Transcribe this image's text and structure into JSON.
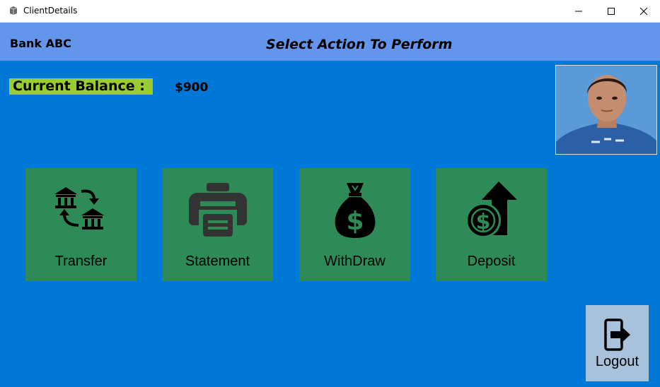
{
  "window": {
    "title": "ClientDetails",
    "icon": "app-box-icon",
    "controls": [
      "minimize-icon",
      "maximize-icon",
      "close-icon"
    ]
  },
  "header": {
    "bank_name": "Bank ABC",
    "title": "Select Action To Perform",
    "background": "#6495ed"
  },
  "balance": {
    "label": "Current Balance :",
    "value": "$900",
    "label_color": "#9acd32"
  },
  "profile_photo": {
    "icon": "client-photo"
  },
  "actions": [
    {
      "label": "Transfer",
      "icon": "bank-transfer-icon"
    },
    {
      "label": "Statement",
      "icon": "printer-icon"
    },
    {
      "label": "WithDraw",
      "icon": "money-bag-icon"
    },
    {
      "label": "Deposit",
      "icon": "coin-arrow-up-icon"
    }
  ],
  "logout": {
    "label": "Logout",
    "icon": "logout-icon"
  },
  "colors": {
    "background": "#0078d7",
    "tile": "#2e8b57",
    "logout_tile": "#a9c2dc"
  }
}
